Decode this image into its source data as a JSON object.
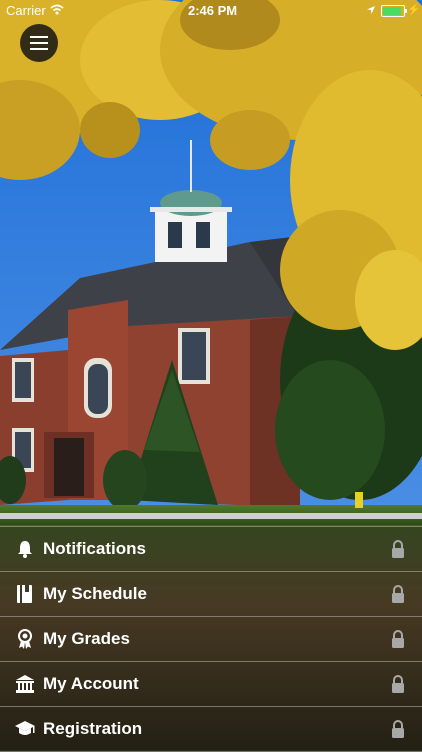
{
  "status_bar": {
    "carrier": "Carrier",
    "time": "2:46 PM",
    "battery_color": "#4cd964"
  },
  "header": {
    "menu_icon": "hamburger-icon"
  },
  "menu": {
    "items": [
      {
        "label": "Notifications",
        "icon": "bell-icon"
      },
      {
        "label": "My Schedule",
        "icon": "book-icon"
      },
      {
        "label": "My Grades",
        "icon": "award-icon"
      },
      {
        "label": "My Account",
        "icon": "bank-icon"
      },
      {
        "label": "Registration",
        "icon": "graduation-cap-icon"
      }
    ],
    "lock_icon": "lock-icon"
  }
}
